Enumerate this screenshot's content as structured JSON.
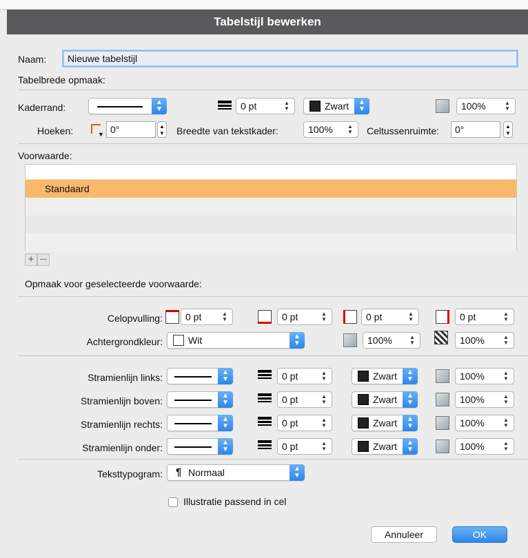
{
  "window": {
    "title": "Tabelstijl bewerken"
  },
  "name": {
    "label": "Naam:",
    "value": "Nieuwe tabelstijl"
  },
  "table_section": {
    "title": "Tabelbrede opmaak:",
    "border_label": "Kaderrand:",
    "border_weight": "0 pt",
    "border_color": "Zwart",
    "border_tint": "100%",
    "corners_label": "Hoeken:",
    "corners_value": "0°",
    "width_label": "Breedte van tekstkader:",
    "width_value": "100%",
    "spacing_label": "Celtussenruimte:",
    "spacing_value": "0°"
  },
  "condition_section": {
    "title": "Voorwaarde:",
    "selected_item": "Standaard",
    "add_label": "+",
    "remove_label": "—"
  },
  "format_section": {
    "title": "Opmaak voor geselecteerde voorwaarde:",
    "cell_padding_label": "Celopvulling:",
    "padding_values": [
      "0 pt",
      "0 pt",
      "0 pt",
      "0 pt"
    ],
    "background_label": "Achtergrondkleur:",
    "background_value": "Wit",
    "background_tint": "100%",
    "background_opacity": "100%"
  },
  "stroke_rows": [
    {
      "label": "Stramienlijn links:",
      "weight": "0 pt",
      "color": "Zwart",
      "tint": "100%"
    },
    {
      "label": "Stramienlijn boven:",
      "weight": "0 pt",
      "color": "Zwart",
      "tint": "100%"
    },
    {
      "label": "Stramienlijn rechts:",
      "weight": "0 pt",
      "color": "Zwart",
      "tint": "100%"
    },
    {
      "label": "Stramienlijn onder:",
      "weight": "0 pt",
      "color": "Zwart",
      "tint": "100%"
    }
  ],
  "text_style": {
    "label": "Teksttypogram:",
    "value": "Normaal",
    "pilcrow": "¶",
    "checkbox_label": "Illustratie passend in cel"
  },
  "buttons": {
    "cancel": "Annuleer",
    "ok": "OK"
  },
  "colors": {
    "selection": "#f9b86a",
    "accent": "#2f86e8",
    "titlebar": "#5a5a5c"
  }
}
